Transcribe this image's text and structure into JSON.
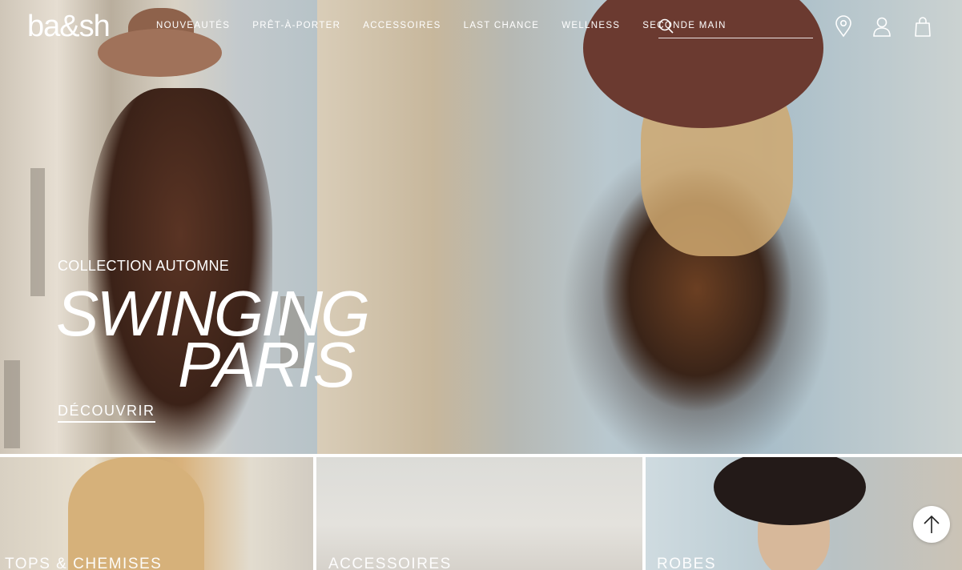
{
  "brand": {
    "logo_text": "ba&sh"
  },
  "nav": {
    "items": [
      {
        "label": "NOUVEAUTÉS"
      },
      {
        "label": "PRÊT-À-PORTER"
      },
      {
        "label": "ACCESSOIRES"
      },
      {
        "label": "LAST CHANCE"
      },
      {
        "label": "WELLNESS"
      },
      {
        "label": "SECONDE MAIN"
      }
    ],
    "search": {
      "placeholder": "",
      "value": "",
      "icon": "search-icon"
    },
    "icons": [
      "store-locator-icon",
      "account-icon",
      "cart-bag-icon"
    ]
  },
  "hero": {
    "kicker": "COLLECTION AUTOMNE",
    "title_line1": "SWINGING",
    "title_line2": "PARIS",
    "cta": "DÉCOUVRIR"
  },
  "categories": [
    {
      "label": "TOPS & CHEMISES"
    },
    {
      "label": "ACCESSOIRES"
    },
    {
      "label": "ROBES"
    }
  ],
  "scroll_top": {
    "icon": "arrow-up-icon"
  },
  "colors": {
    "text_on_image": "#ffffff",
    "button_bg": "#ffffff",
    "icon_dark": "#222222"
  }
}
